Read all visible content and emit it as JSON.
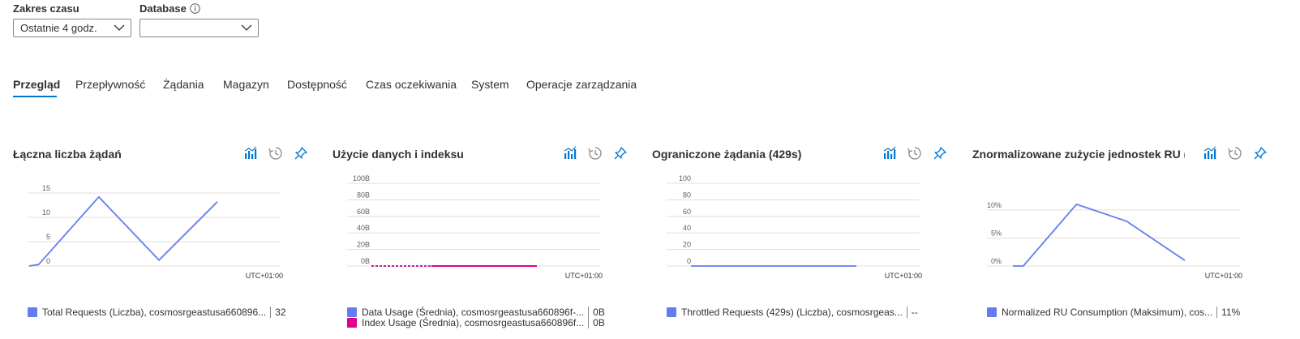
{
  "filters": {
    "time_range_label": "Zakres czasu",
    "time_range_value": "Ostatnie 4 godz.",
    "database_label": "Database",
    "database_value": ""
  },
  "tabs": [
    {
      "label": "Przegląd",
      "active": true
    },
    {
      "label": "Przepływność"
    },
    {
      "label": "Żądania"
    },
    {
      "label": "Magazyn"
    },
    {
      "label": "Dostępność"
    },
    {
      "label": "Czas oczekiwania"
    },
    {
      "label": "System"
    },
    {
      "label": "Operacje zarządzania"
    }
  ],
  "colors": {
    "accent": "#0078d4",
    "series_blue": "#637cef",
    "series_pink": "#e3008c",
    "icon_blue": "#0078d4",
    "icon_gray": "#8a8886"
  },
  "tiles": [
    {
      "title": "Łączna liczba żądań",
      "timezone": "UTC+01:00",
      "legend": [
        {
          "name": "Total Requests (Liczba), cosmosrgeastusa660896...",
          "value": "32",
          "color": "#637cef"
        }
      ]
    },
    {
      "title": "Użycie danych i indeksu",
      "timezone": "UTC+01:00",
      "legend": [
        {
          "name": "Data Usage (Średnia), cosmosrgeastusa660896f-...",
          "value": "0B",
          "color": "#637cef"
        },
        {
          "name": "Index Usage (Średnia), cosmosrgeastusa660896f...",
          "value": "0B",
          "color": "#e3008c"
        }
      ]
    },
    {
      "title": "Ograniczone żądania (429s)",
      "timezone": "UTC+01:00",
      "legend": [
        {
          "name": "Throttled Requests (429s) (Liczba), cosmosrgeas...",
          "value": "--",
          "color": "#637cef"
        }
      ]
    },
    {
      "title": "Znormalizowane zużycie jednostek RU (ma",
      "timezone": "UTC+01:00",
      "legend": [
        {
          "name": "Normalized RU Consumption (Maksimum), cos...",
          "value": "11%",
          "color": "#637cef"
        }
      ]
    }
  ],
  "chart_data": [
    {
      "type": "line",
      "title": "Łączna liczba żądań",
      "y_ticks": [
        "0",
        "5",
        "10",
        "15"
      ],
      "ylim": [
        0,
        15
      ],
      "series": [
        {
          "name": "Total Requests (Liczba), cosmosrgeastusa660896...",
          "values": [
            0,
            0.3,
            14.2,
            1.2,
            13.2
          ]
        }
      ],
      "x_frac": [
        0,
        0.05,
        0.37,
        0.69,
        1.0
      ]
    },
    {
      "type": "line",
      "title": "Użycie danych i indeksu",
      "y_ticks": [
        "0B",
        "20B",
        "40B",
        "60B",
        "80B",
        "100B"
      ],
      "ylim": [
        0,
        100
      ],
      "series": [
        {
          "name": "Data Usage (Średnia), cosmosrgeastusa660896f-...",
          "values": [
            0,
            0
          ]
        },
        {
          "name": "Index Usage (Średnia), cosmosrgeastusa660896f...",
          "values": [
            0,
            0
          ]
        }
      ]
    },
    {
      "type": "line",
      "title": "Ograniczone żądania (429s)",
      "y_ticks": [
        "0",
        "20",
        "40",
        "60",
        "80",
        "100"
      ],
      "ylim": [
        0,
        100
      ],
      "series": [
        {
          "name": "Throttled Requests (429s) (Liczba), cosmosrgeas...",
          "values": [
            0,
            0
          ]
        }
      ]
    },
    {
      "type": "line",
      "title": "Znormalizowane zużycie jednostek RU (ma",
      "y_ticks": [
        "0%",
        "5%",
        "10%"
      ],
      "ylim": [
        0,
        12
      ],
      "series": [
        {
          "name": "Normalized RU Consumption (Maksimum), cos...",
          "values": [
            0,
            0,
            11,
            8,
            1
          ]
        }
      ],
      "x_frac": [
        0,
        0.06,
        0.37,
        0.66,
        1.0
      ]
    }
  ]
}
